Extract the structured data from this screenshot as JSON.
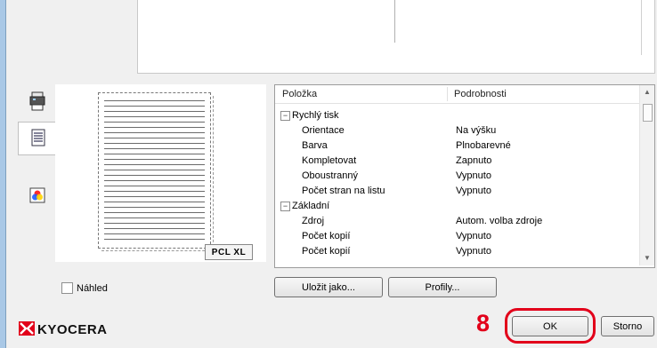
{
  "preview_tabs": [
    {
      "icon": "printer-icon"
    },
    {
      "icon": "document-icon",
      "selected": true
    },
    {
      "icon": "color-icon"
    }
  ],
  "preview": {
    "pdl_badge": "PCL XL"
  },
  "details": {
    "columns": {
      "item": "Položka",
      "details": "Podrobnosti"
    },
    "rows": [
      {
        "type": "group",
        "label": "Rychlý tisk",
        "expander": "−"
      },
      {
        "type": "item",
        "label": "Orientace",
        "value": "Na výšku"
      },
      {
        "type": "item",
        "label": "Barva",
        "value": "Plnobarevné"
      },
      {
        "type": "item",
        "label": "Kompletovat",
        "value": "Zapnuto"
      },
      {
        "type": "item",
        "label": "Oboustranný",
        "value": "Vypnuto"
      },
      {
        "type": "item",
        "label": "Počet stran na listu",
        "value": "Vypnuto"
      },
      {
        "type": "group",
        "label": "Základní",
        "expander": "−"
      },
      {
        "type": "item",
        "label": "Zdroj",
        "value": "Autom. volba zdroje"
      },
      {
        "type": "item",
        "label": "Počet kopií",
        "value": "Vypnuto"
      },
      {
        "type": "item",
        "label": "Počet kopií",
        "value": "Vypnuto"
      }
    ],
    "scroll_up": "▲",
    "scroll_down": "▼"
  },
  "preview_checkbox": {
    "label": "Náhled",
    "checked": false
  },
  "buttons": {
    "save_as": "Uložit jako...",
    "profiles": "Profily...",
    "ok": "OK",
    "cancel": "Storno"
  },
  "brand": {
    "name": "KYOCERA",
    "color": "#e2001a"
  },
  "annotation": {
    "step": "8",
    "color": "#e2001a"
  }
}
